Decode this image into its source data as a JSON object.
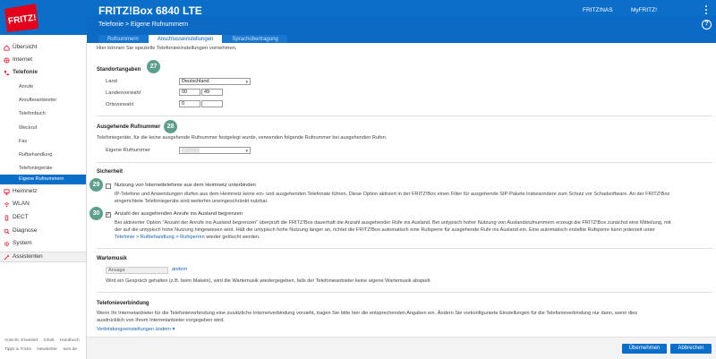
{
  "header": {
    "product": "FRITZ!Box 6840 LTE",
    "links": [
      "FRITZ!NAS",
      "MyFRITZ!"
    ],
    "logo_text": "FRITZ!"
  },
  "subheader": {
    "breadcrumb": "Telefonie > Eigene Rufnummern",
    "help": "?",
    "tabs": [
      {
        "label": "Rufnummern",
        "active": false
      },
      {
        "label": "Anschlusseinstellungen",
        "active": true
      },
      {
        "label": "Sprachübertragung",
        "active": false
      }
    ]
  },
  "sidebar": {
    "items": [
      {
        "label": "Übersicht",
        "icon": "home-icon"
      },
      {
        "label": "Internet",
        "icon": "globe-icon"
      },
      {
        "label": "Telefonie",
        "icon": "phone-icon"
      },
      {
        "label": "Heimnetz",
        "icon": "network-icon"
      },
      {
        "label": "WLAN",
        "icon": "wifi-icon"
      },
      {
        "label": "DECT",
        "icon": "dect-icon"
      },
      {
        "label": "Diagnose",
        "icon": "diagnose-icon"
      },
      {
        "label": "System",
        "icon": "system-icon"
      }
    ],
    "sub_items": [
      "Anrufe",
      "Anrufbeantworter",
      "Telefonbuch",
      "Weckruf",
      "Fax",
      "Rufbehandlung",
      "Telefoniegeräte",
      "Eigene Rufnummern"
    ],
    "assistant": "Assistenten",
    "footer_row1": [
      "Ansicht: Erweitert",
      "Inhalt",
      "Handbuch"
    ],
    "footer_row2": [
      "Tipps & Tricks",
      "Newsletter",
      "avm.de"
    ]
  },
  "main": {
    "intro": "Hier können Sie spezielle Telefonieeinstellungen vornehmen.",
    "standort": {
      "title": "Standortangaben",
      "badge": "27",
      "land_label": "Land",
      "land_value": "Deutschland",
      "landesvorwahl_label": "Landesvorwahl",
      "landesvorwahl_prefix": "00",
      "landesvorwahl_value": "49",
      "ortsvorwahl_label": "Ortsvorwahl",
      "ortsvorwahl_prefix": "0",
      "ortsvorwahl_value": ""
    },
    "ausgehend": {
      "title": "Ausgehende Rufnummer",
      "badge": "28",
      "description": "Telefoniegeräte, für die keine ausgehende Rufnummer festgelegt wurde, verwenden folgende Rufnummer bei ausgehenden Rufen.",
      "label": "Eigene Rufnummer",
      "value": "(hidden)"
    },
    "sicherheit": {
      "title": "Sicherheit",
      "badge1": "29",
      "option1_label": "Nutzung von Internettelefonie aus dem Heimnetz unterbinden",
      "option1_checked": false,
      "option1_desc1": "IP-Telefone und Anwendungen dürfen aus dem Heimnetz keine ein- und ausgehenden Telefonate führen. Diese Option aktiviert in der FRITZ!Box einen Filter für ausgehende SIP-Pakete insbesondere zum Schutz vor Schadsoftware. An der FRITZ!Box",
      "option1_desc2": "eingerichtete Telefoniegeräte sind weiterhin uneingeschränkt nutzbar.",
      "badge2": "30",
      "option2_label": "Anzahl der ausgehenden Anrufe ins Ausland begrenzen",
      "option2_checked": true,
      "option2_desc1": "Bei aktivierter Option \"Anzahl der Anrufe ins Ausland begrenzen\" überprüft die FRITZ!Box dauerhaft die Anzahl ausgehender Rufe ins Ausland. Bei untypisch hoher Nutzung von Auslandsrufnummern erzeugt die FRITZ!Box zunächst eine Mitteilung, mit",
      "option2_desc2": "der auf die untypisch hohe Nutzung hingewiesen wird. Hält die untypisch hohe Nutzung länger an, richtet die FRITZ!Box automatisch eine Rufsperre für ausgehende Rufe ins Ausland ein. Eine automatisch erstellte Rufsperre kann jederzeit unter",
      "option2_desc3_pre": "Telefonie > Rufbehandlung > Rufsperren",
      "option2_desc3_post": " wieder gelöscht werden."
    },
    "wartemusik": {
      "title": "Wartemusik",
      "value": "Ansage",
      "change_link": "ändern",
      "description": "Wird ein Gespräch gehalten (z.B. beim Makeln), wird die Wartemusik wiedergegeben, falls der Telefonieanbieter keine eigene Wartemusik abspielt."
    },
    "telefonieverbindung": {
      "title": "Telefonieverbindung",
      "description1": "Wenn Ihr Internetanbieter für die Telefonieverbindung eine zusätzliche Internetverbindung vorsieht, tragen Sie bitte hier die entsprechenden Angaben ein. Ändern Sie vorkonfigurierte Einstellungen für die Telefonieverbindung nur dann, wenn dies",
      "description2": "ausdrücklich von Ihrem Internetanbieter vorgegeben wird.",
      "link": "Verbindungseinstellungen ändern"
    }
  },
  "buttons": {
    "apply": "Übernehmen",
    "cancel": "Abbrechen"
  },
  "colors": {
    "brand_blue": "#0b6ec8",
    "badge": "#5d9e8d"
  }
}
